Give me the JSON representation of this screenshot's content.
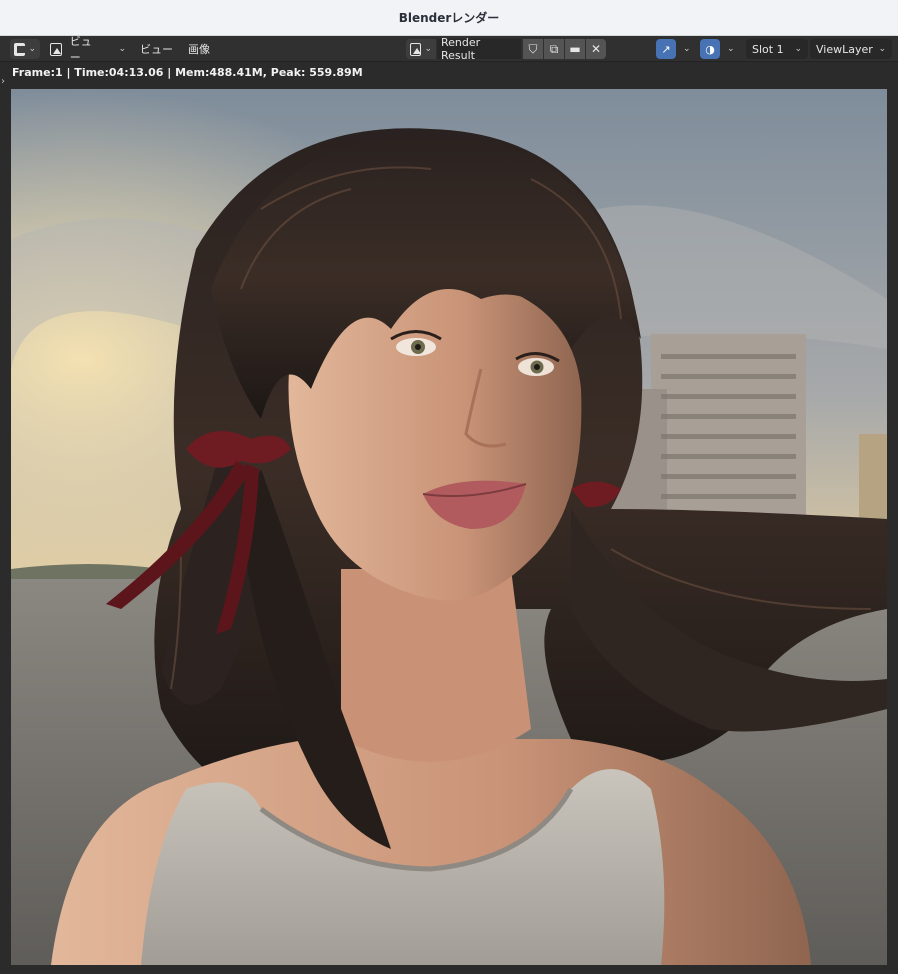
{
  "window": {
    "title": "Blenderレンダー"
  },
  "header": {
    "view_menu_1": "ビュー",
    "view_menu_2": "ビュー",
    "image_menu": "画像",
    "image_name": "Render Result",
    "slot": "Slot 1",
    "view_layer": "ViewLayer"
  },
  "status": {
    "text": "Frame:1 | Time:04:13.06 | Mem:488.41M, Peak: 559.89M"
  },
  "icons": {
    "editor_type": "image-editor-icon",
    "mode": "view-mode-icon",
    "shield": "fake-user-shield-icon",
    "duplicate": "duplicate-icon",
    "folder": "folder-icon",
    "close": "close-icon",
    "gizmo": "gizmo-icon",
    "overlay": "overlay-icon"
  },
  "colors": {
    "accent": "#4772b3",
    "header_bg": "#303030",
    "title_bg": "#f2f3f7"
  },
  "render_content": "3D rendered portrait of a woman with dark twin-tail hair and red ribbons on a beach at sunset"
}
